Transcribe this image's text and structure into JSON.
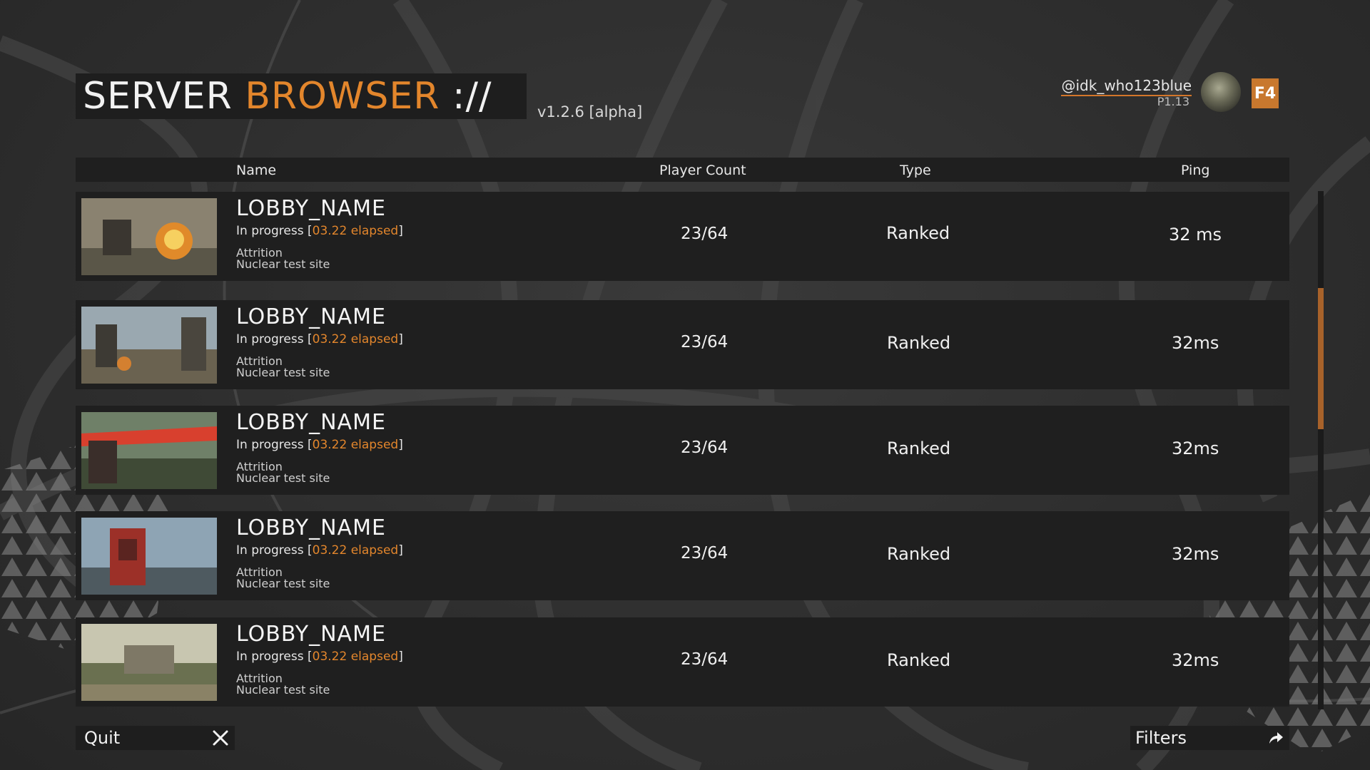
{
  "header": {
    "title_part1": "SERVER",
    "title_part2": "BROWSER",
    "title_part3": "://",
    "version": "v1.2.6 [alpha]"
  },
  "profile": {
    "username": "@idk_who123blue",
    "level": "P1.13",
    "hotkey": "F4"
  },
  "table": {
    "columns": {
      "name": "Name",
      "player_count": "Player Count",
      "type": "Type",
      "ping": "Ping"
    },
    "rows": [
      {
        "name": "LOBBY_NAME",
        "status_prefix": "In progress [",
        "elapsed": "03.22 elapsed",
        "status_suffix": "]",
        "mode": "Attrition",
        "map": "Nuclear test site",
        "players": "23/64",
        "type": "Ranked",
        "ping": "32 ms"
      },
      {
        "name": "LOBBY_NAME",
        "status_prefix": "In progress [",
        "elapsed": "03.22 elapsed",
        "status_suffix": "]",
        "mode": "Attrition",
        "map": "Nuclear test site",
        "players": "23/64",
        "type": "Ranked",
        "ping": "32ms"
      },
      {
        "name": "LOBBY_NAME",
        "status_prefix": "In progress [",
        "elapsed": "03.22 elapsed",
        "status_suffix": "]",
        "mode": "Attrition",
        "map": "Nuclear test site",
        "players": "23/64",
        "type": "Ranked",
        "ping": "32ms"
      },
      {
        "name": "LOBBY_NAME",
        "status_prefix": "In progress [",
        "elapsed": "03.22 elapsed",
        "status_suffix": "]",
        "mode": "Attrition",
        "map": "Nuclear test site",
        "players": "23/64",
        "type": "Ranked",
        "ping": "32ms"
      },
      {
        "name": "LOBBY_NAME",
        "status_prefix": "In progress [",
        "elapsed": "03.22 elapsed",
        "status_suffix": "]",
        "mode": "Attrition",
        "map": "Nuclear test site",
        "players": "23/64",
        "type": "Ranked",
        "ping": "32ms"
      }
    ]
  },
  "footer": {
    "quit_label": "Quit",
    "quit_icon": "close-icon",
    "filters_label": "Filters",
    "filters_icon": "share-arrow-icon"
  },
  "colors": {
    "accent": "#e3862c",
    "panel": "#1f1f1f",
    "background": "#2e2e2e"
  }
}
